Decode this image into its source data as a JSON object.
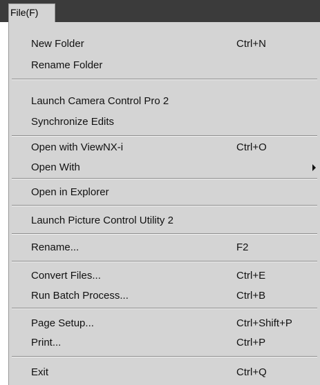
{
  "menubar": {
    "file_label": "File(F)"
  },
  "menu": {
    "items": [
      {
        "label": "New Folder",
        "shortcut": "Ctrl+N"
      },
      {
        "label": "Rename Folder",
        "shortcut": ""
      },
      {
        "label": "Launch Camera Control Pro 2",
        "shortcut": ""
      },
      {
        "label": "Synchronize Edits",
        "shortcut": ""
      },
      {
        "label": "Open with ViewNX-i",
        "shortcut": "Ctrl+O"
      },
      {
        "label": "Open With",
        "shortcut": "",
        "submenu": true
      },
      {
        "label": "Open in Explorer",
        "shortcut": ""
      },
      {
        "label": "Launch Picture Control Utility 2",
        "shortcut": ""
      },
      {
        "label": "Rename...",
        "shortcut": "F2"
      },
      {
        "label": "Convert Files...",
        "shortcut": "Ctrl+E"
      },
      {
        "label": "Run Batch Process...",
        "shortcut": "Ctrl+B"
      },
      {
        "label": "Page Setup...",
        "shortcut": "Ctrl+Shift+P"
      },
      {
        "label": "Print...",
        "shortcut": "Ctrl+P"
      },
      {
        "label": "Exit",
        "shortcut": "Ctrl+Q"
      }
    ]
  },
  "colors": {
    "menubar_bg": "#3b3b3b",
    "menu_bg": "#d4d4d4",
    "text": "#111111"
  }
}
